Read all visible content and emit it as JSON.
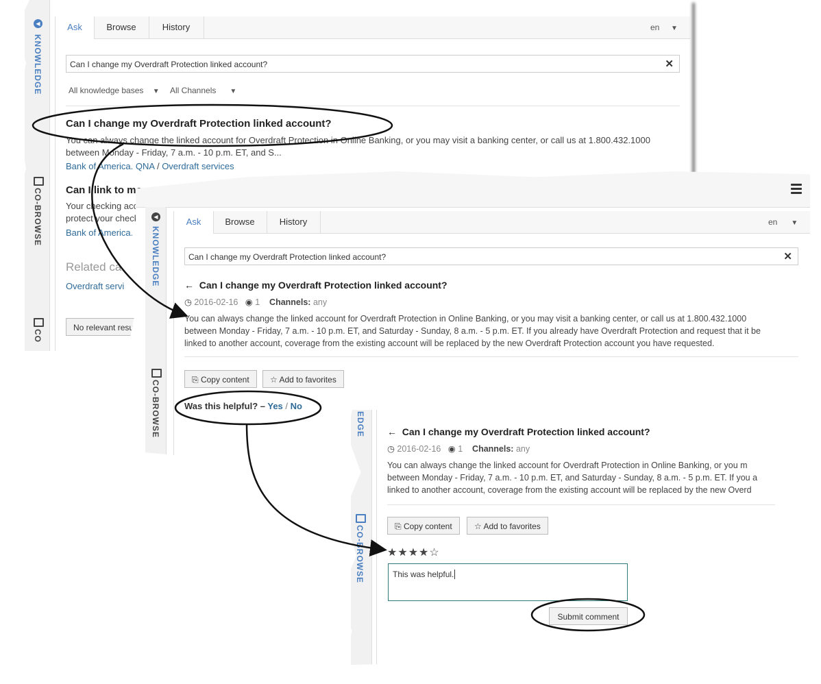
{
  "panel1": {
    "sidebar": {
      "knowledge_label": "KNOWLEDGE",
      "cobrowse_label": "CO-BROWSE",
      "third_label": "CO"
    },
    "tabs": [
      {
        "label": "Ask"
      },
      {
        "label": "Browse"
      },
      {
        "label": "History"
      }
    ],
    "language": "en",
    "search": {
      "value": "Can I change my Overdraft Protection linked account?"
    },
    "filters": {
      "knowledge_bases": "All knowledge bases",
      "channels": "All Channels"
    },
    "results": [
      {
        "title": "Can I change my Overdraft Protection linked account?",
        "snippet_line1": "You can always change the linked account for Overdraft Protection in Online Banking, or you may visit a banking center, or call us at 1.800.432.1000",
        "snippet_line2": "between Monday - Friday, 7 a.m. - 10 p.m. ET, and S...",
        "source": "Bank of America. QNA",
        "category": "Overdraft services"
      },
      {
        "title": "Can I link to mo",
        "snippet_line1": "Your checking acco",
        "snippet_line2": "protect your checki",
        "source": "Bank of America."
      }
    ],
    "related_heading": "Related ca",
    "related_link": "Overdraft servi",
    "no_results": "No relevant results"
  },
  "panel2": {
    "sidebar": {
      "knowledge_label": "KNOWLEDGE",
      "cobrowse_label": "CO-BROWSE"
    },
    "tabs": [
      {
        "label": "Ask"
      },
      {
        "label": "Browse"
      },
      {
        "label": "History"
      }
    ],
    "language": "en",
    "search": {
      "value": "Can I change my Overdraft Protection linked account?"
    },
    "article": {
      "title": "Can I change my Overdraft Protection linked account?",
      "date": "2016-02-16",
      "views": "1",
      "channels_label": "Channels:",
      "channels_value": "any",
      "body_line1": "You can always change the linked account for Overdraft Protection in Online Banking, or you may visit a banking center, or call us at 1.800.432.1000",
      "body_line2": "between Monday - Friday, 7 a.m. - 10 p.m. ET, and Saturday - Sunday, 8 a.m. - 5 p.m. ET. If you already have Overdraft Protection and request that it be",
      "body_line3": "linked to another account, coverage from the existing account will be replaced by the new Overdraft Protection account you have requested."
    },
    "copy_label": "Copy content",
    "favorites_label": "Add to favorites",
    "helpful": {
      "question": "Was this helpful? –",
      "yes": "Yes",
      "sep": "/",
      "no": "No"
    }
  },
  "panel3": {
    "sidebar": {
      "knowledge_label": "EDGE",
      "cobrowse_label": "CO-BROWSE"
    },
    "article": {
      "title": "Can I change my Overdraft Protection linked account?",
      "date": "2016-02-16",
      "views": "1",
      "channels_label": "Channels:",
      "channels_value": "any",
      "body_line1": "You can always change the linked account for Overdraft Protection in Online Banking, or you m",
      "body_line2": "between Monday - Friday, 7 a.m. - 10 p.m. ET, and Saturday - Sunday, 8 a.m. - 5 p.m. ET. If you a",
      "body_line3": "linked to another account, coverage from the existing account will be replaced by the new Overd"
    },
    "copy_label": "Copy content",
    "favorites_label": "Add to favorites",
    "rating": {
      "filled": "★★★★",
      "empty": "☆",
      "value": 4,
      "max": 5
    },
    "comment": {
      "value": "This was helpful."
    },
    "submit_label": "Submit comment"
  },
  "colors": {
    "accent": "#4a7fc1",
    "link": "#2f6b99",
    "comment_border": "#2f7a7a"
  }
}
